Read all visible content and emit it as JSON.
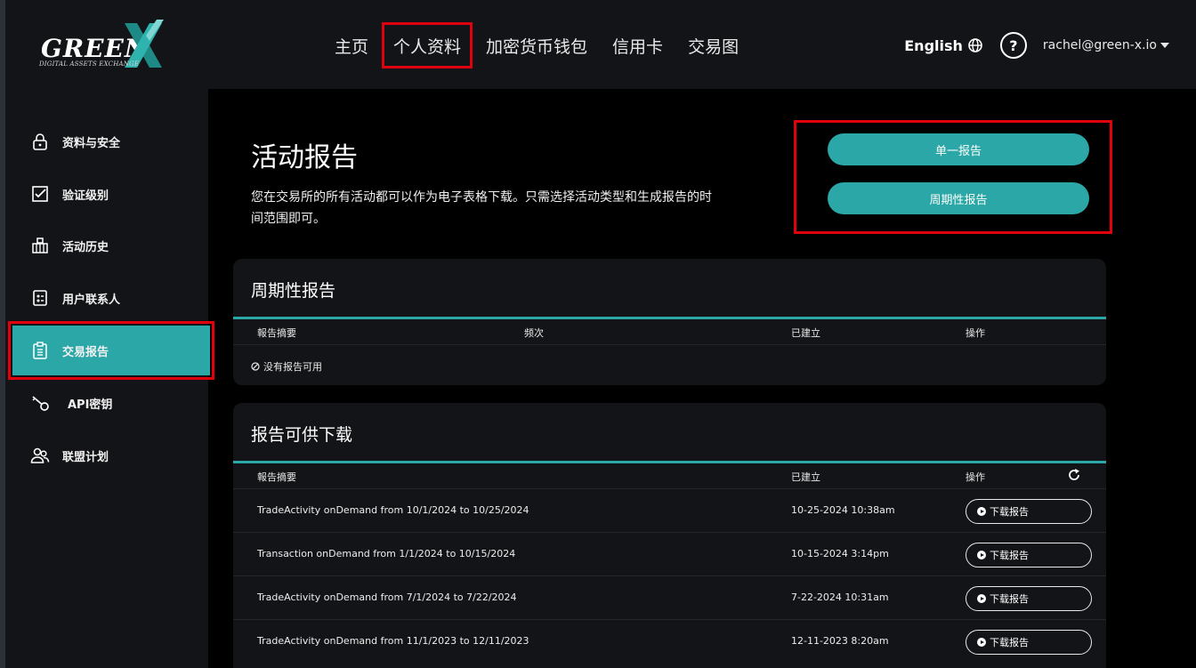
{
  "brand": {
    "name": "GREEN",
    "tagline": "DIGITAL ASSETS EXCHANGE"
  },
  "nav": {
    "items": [
      {
        "label": "主页"
      },
      {
        "label": "个人资料"
      },
      {
        "label": "加密货币钱包"
      },
      {
        "label": "信用卡"
      },
      {
        "label": "交易图"
      }
    ]
  },
  "header": {
    "language": "English",
    "user_email": "rachel@green-x.io"
  },
  "sidebar": {
    "items": [
      {
        "label": "资料与安全",
        "icon": "lock-icon"
      },
      {
        "label": "验证级别",
        "icon": "checkbox-icon"
      },
      {
        "label": "活动历史",
        "icon": "bank-icon"
      },
      {
        "label": "用户联系人",
        "icon": "contacts-icon"
      },
      {
        "label": "交易报告",
        "icon": "clipboard-icon",
        "active": true
      },
      {
        "label": "API密钥",
        "icon": "key-icon"
      },
      {
        "label": "联盟计划",
        "icon": "users-icon"
      }
    ]
  },
  "page": {
    "title": "活动报告",
    "description": "您在交易所的所有活动都可以作为电子表格下载。只需选择活动类型和生成报告的时间范围即可。",
    "buttons": {
      "single": "单一报告",
      "periodic": "周期性报告"
    }
  },
  "periodic": {
    "title": "周期性报告",
    "columns": [
      "報告摘要",
      "频次",
      "已建立",
      "操作"
    ],
    "empty_text": "没有报告可用"
  },
  "downloads": {
    "title": "报告可供下载",
    "columns": [
      "報告摘要",
      "已建立",
      "操作"
    ],
    "button_label": "下载报告",
    "rows": [
      {
        "summary": "TradeActivity onDemand from 10/1/2024 to 10/25/2024",
        "created": "10-25-2024 10:38am"
      },
      {
        "summary": "Transaction onDemand from 1/1/2024 to 10/15/2024",
        "created": "10-15-2024 3:14pm"
      },
      {
        "summary": "TradeActivity onDemand from 7/1/2024 to 7/22/2024",
        "created": "7-22-2024 10:31am"
      },
      {
        "summary": "TradeActivity onDemand from 11/1/2023 to 12/11/2023",
        "created": "12-11-2023 8:20am"
      }
    ]
  },
  "colors": {
    "accent": "#2aa7a6",
    "highlight": "#e0000e",
    "panel": "#131417"
  }
}
